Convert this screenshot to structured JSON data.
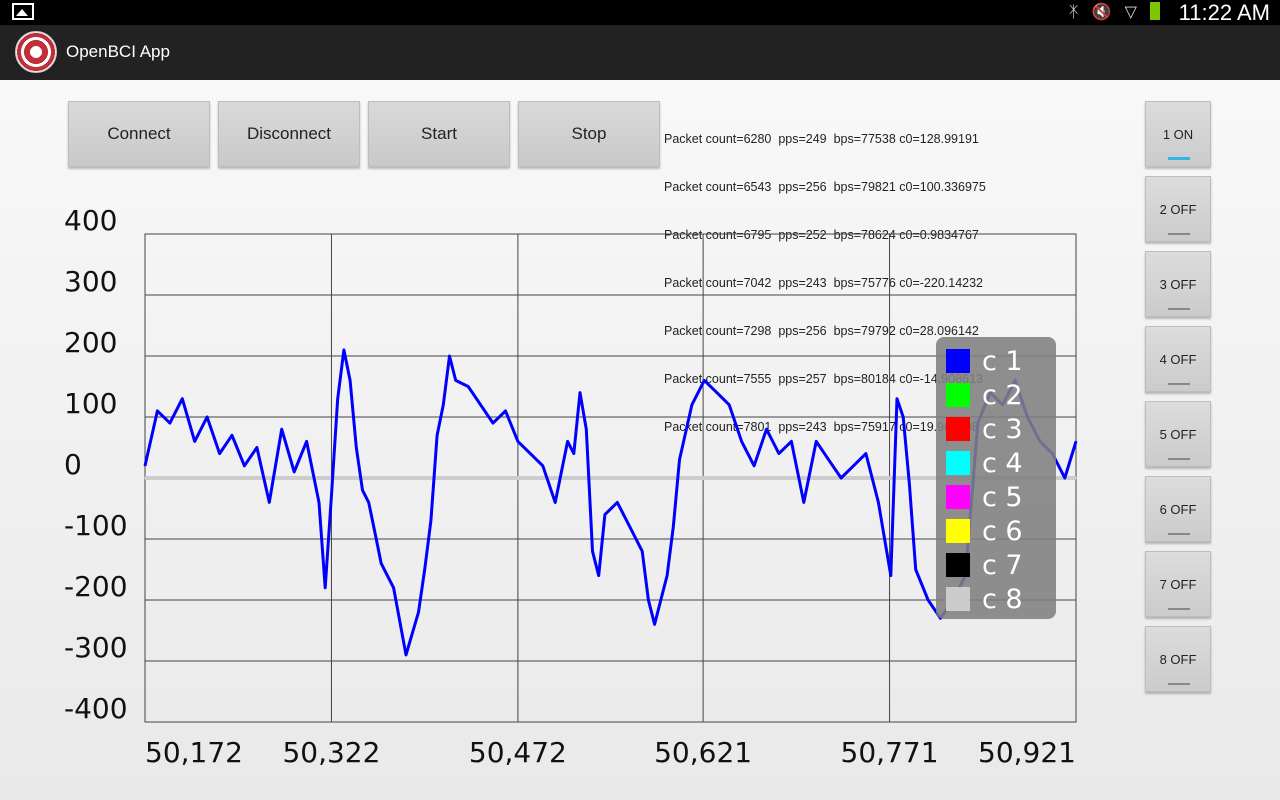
{
  "status_bar": {
    "clock": "11:22 AM",
    "icons": [
      "gallery-icon",
      "bluetooth-icon",
      "mute-icon",
      "wifi-icon",
      "battery-icon"
    ]
  },
  "app": {
    "title": "OpenBCI App"
  },
  "toolbar": {
    "connect_label": "Connect",
    "disconnect_label": "Disconnect",
    "start_label": "Start",
    "stop_label": "Stop"
  },
  "log_lines": [
    "Packet count=6280  pps=249  bps=77538 c0=128.99191",
    "Packet count=6543  pps=256  bps=79821 c0=100.336975",
    "Packet count=6795  pps=252  bps=78624 c0=0.9834767",
    "Packet count=7042  pps=243  bps=75776 c0=-220.14232",
    "Packet count=7298  pps=256  bps=79792 c0=28.096142",
    "Packet count=7555  pps=257  bps=80184 c0=-14.908613",
    "Packet count=7801  pps=243  bps=75917 c0=19.960108"
  ],
  "channel_toggles": [
    {
      "label": "1 ON",
      "state": "on"
    },
    {
      "label": "2 OFF",
      "state": "off"
    },
    {
      "label": "3 OFF",
      "state": "off"
    },
    {
      "label": "4 OFF",
      "state": "off"
    },
    {
      "label": "5 OFF",
      "state": "off"
    },
    {
      "label": "6 OFF",
      "state": "off"
    },
    {
      "label": "7 OFF",
      "state": "off"
    },
    {
      "label": "8 OFF",
      "state": "off"
    }
  ],
  "chart_data": {
    "type": "line",
    "title": "",
    "xlabel": "",
    "ylabel": "",
    "ylim": [
      -400,
      400
    ],
    "xlim": [
      50172,
      50921
    ],
    "y_ticks": [
      "400",
      "300",
      "200",
      "100",
      "0",
      "-100",
      "-200",
      "-300",
      "-400"
    ],
    "x_ticks": [
      "50,172",
      "50,322",
      "50,472",
      "50,621",
      "50,771",
      "50,921"
    ],
    "grid": true,
    "legend_position": "right",
    "legend": [
      {
        "name": "c 1",
        "color": "#0000ff"
      },
      {
        "name": "c 2",
        "color": "#00ff00"
      },
      {
        "name": "c 3",
        "color": "#ff0000"
      },
      {
        "name": "c 4",
        "color": "#00ffff"
      },
      {
        "name": "c 5",
        "color": "#ff00ff"
      },
      {
        "name": "c 6",
        "color": "#ffff00"
      },
      {
        "name": "c 7",
        "color": "#000000"
      },
      {
        "name": "c 8",
        "color": "#cccccc"
      }
    ],
    "series": [
      {
        "name": "c 1",
        "color": "#0000ff",
        "x": [
          50172,
          50182,
          50192,
          50202,
          50212,
          50222,
          50232,
          50242,
          50252,
          50262,
          50272,
          50282,
          50292,
          50302,
          50312,
          50317,
          50322,
          50327,
          50332,
          50337,
          50342,
          50347,
          50352,
          50357,
          50362,
          50372,
          50382,
          50392,
          50397,
          50402,
          50407,
          50412,
          50417,
          50422,
          50432,
          50442,
          50452,
          50462,
          50472,
          50482,
          50492,
          50502,
          50512,
          50517,
          50522,
          50527,
          50532,
          50537,
          50542,
          50552,
          50562,
          50572,
          50577,
          50582,
          50587,
          50592,
          50597,
          50602,
          50612,
          50622,
          50632,
          50642,
          50652,
          50662,
          50672,
          50682,
          50692,
          50702,
          50712,
          50722,
          50732,
          50742,
          50752,
          50762,
          50767,
          50772,
          50777,
          50782,
          50787,
          50792,
          50802,
          50812,
          50822,
          50832,
          50842,
          50852,
          50862,
          50872,
          50882,
          50892,
          50902,
          50912,
          50921
        ],
        "y": [
          20,
          110,
          90,
          130,
          60,
          100,
          40,
          70,
          20,
          50,
          -40,
          80,
          10,
          60,
          -40,
          -180,
          -30,
          130,
          210,
          160,
          50,
          -20,
          -40,
          -90,
          -140,
          -180,
          -290,
          -220,
          -150,
          -70,
          70,
          120,
          200,
          160,
          150,
          120,
          90,
          110,
          60,
          40,
          20,
          -40,
          60,
          40,
          140,
          80,
          -120,
          -160,
          -60,
          -40,
          -80,
          -120,
          -200,
          -240,
          -200,
          -160,
          -80,
          30,
          120,
          160,
          140,
          120,
          60,
          20,
          80,
          40,
          60,
          -40,
          60,
          30,
          0,
          20,
          40,
          -40,
          -100,
          -160,
          130,
          100,
          -10,
          -150,
          -200,
          -230,
          -200,
          -160,
          90,
          140,
          120,
          160,
          100,
          60,
          40,
          0,
          60
        ]
      },
      {
        "name": "c 8",
        "color": "#cccccc",
        "x": [
          50172,
          50921
        ],
        "y": [
          0,
          0
        ]
      }
    ]
  }
}
